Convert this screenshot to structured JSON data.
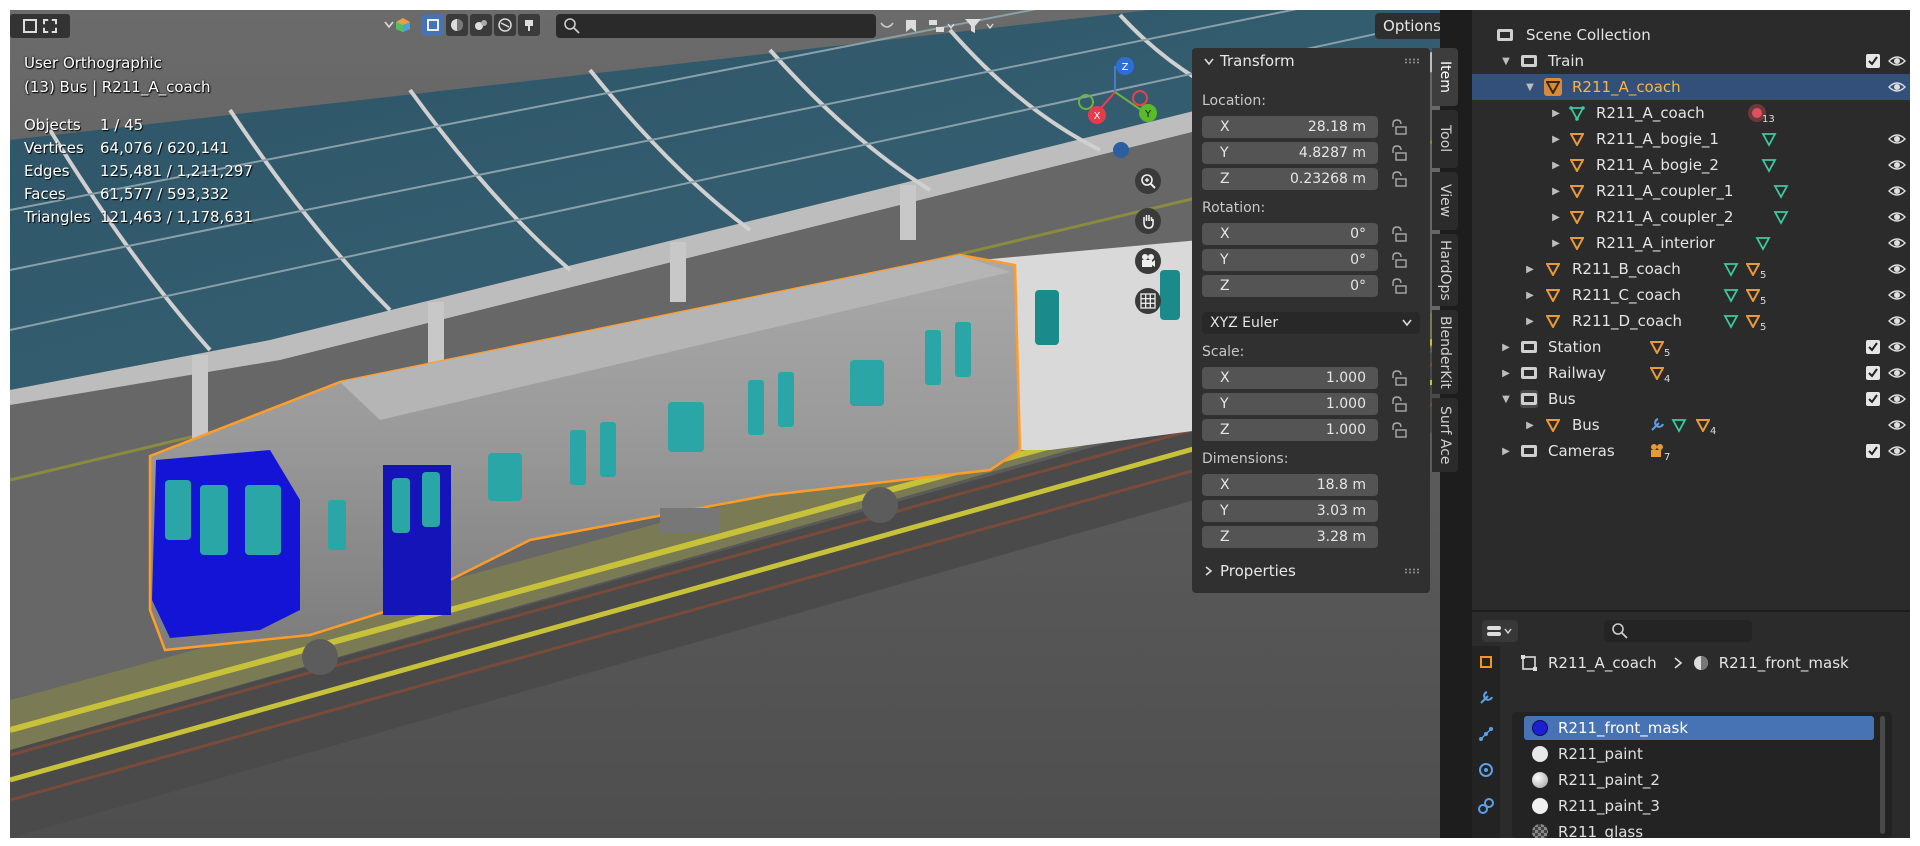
{
  "viewport": {
    "view_name": "User Orthographic",
    "context": "(13) Bus | R211_A_coach",
    "stats": [
      {
        "label": "Objects",
        "value": "1 / 45"
      },
      {
        "label": "Vertices",
        "value": "64,076 / 620,141"
      },
      {
        "label": "Edges",
        "value": "125,481 / 1,211,297"
      },
      {
        "label": "Faces",
        "value": "61,577 / 593,332"
      },
      {
        "label": "Triangles",
        "value": "121,463 / 1,178,631"
      }
    ],
    "options_label": "Options",
    "gizmo": {
      "x": "X",
      "y": "Y",
      "z": "Z"
    }
  },
  "npanel": {
    "section_title": "Transform",
    "location_label": "Location:",
    "location": [
      {
        "axis": "X",
        "value": "28.18 m"
      },
      {
        "axis": "Y",
        "value": "4.8287 m"
      },
      {
        "axis": "Z",
        "value": "0.23268 m"
      }
    ],
    "rotation_label": "Rotation:",
    "rotation": [
      {
        "axis": "X",
        "value": "0°"
      },
      {
        "axis": "Y",
        "value": "0°"
      },
      {
        "axis": "Z",
        "value": "0°"
      }
    ],
    "rotation_mode": "XYZ Euler",
    "scale_label": "Scale:",
    "scale": [
      {
        "axis": "X",
        "value": "1.000"
      },
      {
        "axis": "Y",
        "value": "1.000"
      },
      {
        "axis": "Z",
        "value": "1.000"
      }
    ],
    "dimensions_label": "Dimensions:",
    "dimensions": [
      {
        "axis": "X",
        "value": "18.8 m"
      },
      {
        "axis": "Y",
        "value": "3.03 m"
      },
      {
        "axis": "Z",
        "value": "3.28 m"
      }
    ],
    "properties_label": "Properties"
  },
  "sidetabs": [
    "Item",
    "Tool",
    "View",
    "HardOps",
    "BlenderKit",
    "Surf Ace"
  ],
  "outliner": {
    "rows": [
      {
        "name": "Scene Collection",
        "type": "scene",
        "depth": 0
      },
      {
        "name": "Train",
        "type": "collection",
        "depth": 1,
        "expanded": true,
        "check": true
      },
      {
        "name": "R211_A_coach",
        "type": "object",
        "depth": 2,
        "expanded": true,
        "selected": true
      },
      {
        "name": "R211_A_coach",
        "type": "mesh",
        "depth": 3,
        "badge": "13"
      },
      {
        "name": "R211_A_bogie_1",
        "type": "object",
        "depth": 3
      },
      {
        "name": "R211_A_bogie_2",
        "type": "object",
        "depth": 3
      },
      {
        "name": "R211_A_coupler_1",
        "type": "object",
        "depth": 3
      },
      {
        "name": "R211_A_coupler_2",
        "type": "object",
        "depth": 3
      },
      {
        "name": "R211_A_interior",
        "type": "object",
        "depth": 3
      },
      {
        "name": "R211_B_coach",
        "type": "object",
        "depth": 2,
        "badge": "5"
      },
      {
        "name": "R211_C_coach",
        "type": "object",
        "depth": 2,
        "badge": "5"
      },
      {
        "name": "R211_D_coach",
        "type": "object",
        "depth": 2,
        "badge": "5"
      },
      {
        "name": "Station",
        "type": "collection",
        "depth": 1,
        "check": true,
        "badge": "5"
      },
      {
        "name": "Railway",
        "type": "collection",
        "depth": 1,
        "check": true,
        "badge": "4"
      },
      {
        "name": "Bus",
        "type": "collection",
        "depth": 1,
        "expanded": true,
        "check": true
      },
      {
        "name": "Bus",
        "type": "object",
        "depth": 2,
        "badge": "4"
      },
      {
        "name": "Cameras",
        "type": "collection",
        "depth": 1,
        "check": true,
        "badge": "7"
      }
    ]
  },
  "properties": {
    "breadcrumb_object": "R211_A_coach",
    "breadcrumb_material": "R211_front_mask",
    "materials": [
      {
        "name": "R211_front_mask",
        "color": "#1f1fd0",
        "selected": true
      },
      {
        "name": "R211_paint",
        "color": "#e8e8e8"
      },
      {
        "name": "R211_paint_2",
        "color": "#e0e0e0"
      },
      {
        "name": "R211_paint_3",
        "color": "#f0f0f0"
      },
      {
        "name": "R211_glass",
        "color": "#6a6a6a"
      }
    ]
  },
  "colors": {
    "accent": "#ffa020",
    "selection": "#4772b3",
    "outliner_selected": "#33507a"
  }
}
